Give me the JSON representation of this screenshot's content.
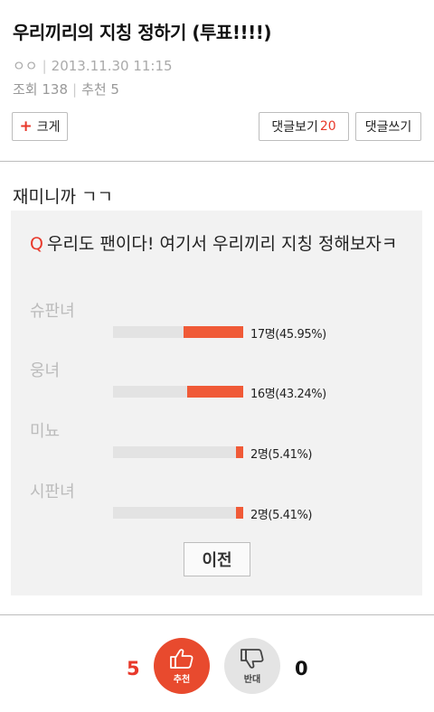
{
  "post": {
    "title": "우리끼리의 지칭 정하기 (투표!!!!)",
    "author": "ㅇㅇ",
    "datetime": "2013.11.30 11:15",
    "views_label": "조회 138",
    "recommend_label": "추천 5",
    "body": "재미니까 ㄱㄱ"
  },
  "toolbar": {
    "enlarge_label": "크게",
    "view_comments_label": "댓글보기",
    "comment_count": "20",
    "write_comment_label": "댓글쓰기"
  },
  "poll": {
    "q_mark": "Q",
    "question": "우리도 팬이다! 여기서 우리끼리 지칭 정해보자ㅋ",
    "options": [
      {
        "label": "슈판녀",
        "count_text": "17명(45.95%)",
        "percent": 45.95
      },
      {
        "label": "웅녀",
        "count_text": "16명(43.24%)",
        "percent": 43.24
      },
      {
        "label": "미뇨",
        "count_text": "2명(5.41%)",
        "percent": 5.41
      },
      {
        "label": "시판녀",
        "count_text": "2명(5.41%)",
        "percent": 5.41
      }
    ],
    "prev_label": "이전"
  },
  "votes": {
    "up_count": "5",
    "up_label": "추천",
    "down_count": "0",
    "down_label": "반대"
  },
  "colors": {
    "accent": "#e8382a",
    "bar_fill": "#f05a37",
    "bar_track": "#e3e3e3",
    "poll_bg": "#f2f2f2"
  }
}
